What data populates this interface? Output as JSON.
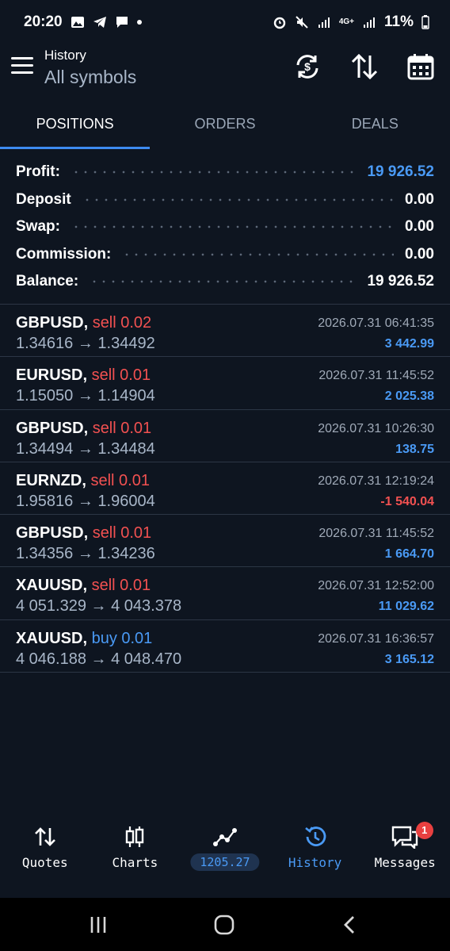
{
  "status_bar": {
    "time": "20:20",
    "network": "4G+",
    "battery": "11%"
  },
  "header": {
    "subtitle": "History",
    "title": "All symbols",
    "icons": [
      "menu-icon",
      "sync-currency-icon",
      "sort-icon",
      "calendar-icon"
    ]
  },
  "tabs": [
    {
      "label": "POSITIONS",
      "active": true
    },
    {
      "label": "ORDERS",
      "active": false
    },
    {
      "label": "DEALS",
      "active": false
    }
  ],
  "summary": {
    "profit": {
      "label": "Profit:",
      "value": "19 926.52"
    },
    "deposit": {
      "label": "Deposit",
      "value": "0.00"
    },
    "swap": {
      "label": "Swap:",
      "value": "0.00"
    },
    "commission": {
      "label": "Commission:",
      "value": "0.00"
    },
    "balance": {
      "label": "Balance:",
      "value": "19 926.52"
    }
  },
  "trades": [
    {
      "symbol": "GBPUSD,",
      "side": "sell 0.02",
      "prices": "1.34616 → 1.34492",
      "time": "2026.07.31 06:41:35",
      "profit": "3 442.99"
    },
    {
      "symbol": "EURUSD,",
      "side": "sell 0.01",
      "prices": "1.15050 → 1.14904",
      "time": "2026.07.31 11:45:52",
      "profit": "2 025.38"
    },
    {
      "symbol": "GBPUSD,",
      "side": "sell 0.01",
      "prices": "1.34494 → 1.34484",
      "time": "2026.07.31 10:26:30",
      "profit": "138.75"
    },
    {
      "symbol": "EURNZD,",
      "side": "sell 0.01",
      "prices": "1.95816 → 1.96004",
      "time": "2026.07.31 12:19:24",
      "profit": "-1 540.04"
    },
    {
      "symbol": "GBPUSD,",
      "side": "sell 0.01",
      "prices": "1.34356 → 1.34236",
      "time": "2026.07.31 11:45:52",
      "profit": "1 664.70"
    },
    {
      "symbol": "XAUUSD,",
      "side": "sell 0.01",
      "prices": "4 051.329 → 4 043.378",
      "time": "2026.07.31 12:52:00",
      "profit": "11 029.62"
    },
    {
      "symbol": "XAUUSD,",
      "side": "buy 0.01",
      "prices": "4 046.188 → 4 048.470",
      "time": "2026.07.31 16:36:57",
      "profit": "3 165.12"
    }
  ],
  "bottom_nav": {
    "quotes": "Quotes",
    "charts": "Charts",
    "equity": "1205.27",
    "history": "History",
    "messages": "Messages",
    "messages_badge": "1"
  },
  "colors": {
    "background": "#0e1520",
    "accent": "#4a9af5",
    "sell": "#f25151",
    "text_muted": "#a8b6c8"
  }
}
